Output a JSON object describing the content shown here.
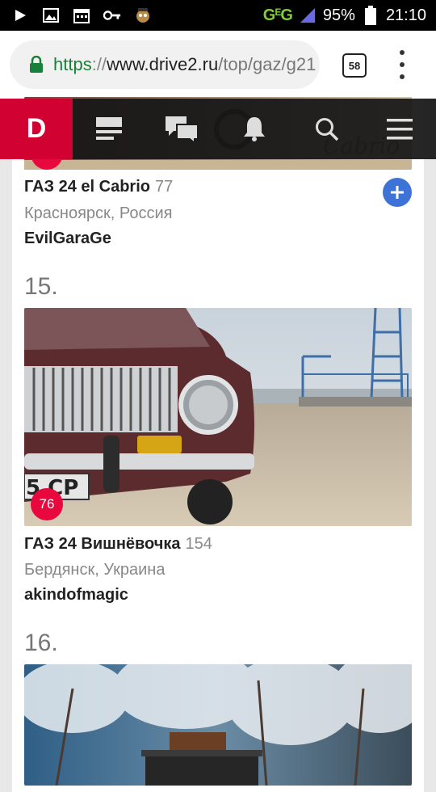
{
  "status_bar": {
    "battery_percent": "95%",
    "time": "21:10",
    "network_label": "G",
    "network_sub": "E",
    "network_label2": "G"
  },
  "browser": {
    "url_scheme": "https",
    "url_sep": "://",
    "url_host": "www.drive2.ru",
    "url_path": "/top/gaz/g21",
    "tab_count": "58"
  },
  "site": {
    "logo": "D"
  },
  "items": [
    {
      "title": "ГАЗ 24 el Cabrio",
      "count": "77",
      "location": "Красноярск, Россия",
      "author": "EvilGaraGe"
    },
    {
      "rank": "15.",
      "badge": "76",
      "title": "ГАЗ 24 Вишнёвочка",
      "count": "154",
      "location": "Бердянск, Украина",
      "author": "akindofmagic"
    },
    {
      "rank": "16."
    }
  ],
  "colors": {
    "brand": "#d10232",
    "badge": "#e8083e",
    "follow": "#3d73d6",
    "secure": "#188038"
  }
}
